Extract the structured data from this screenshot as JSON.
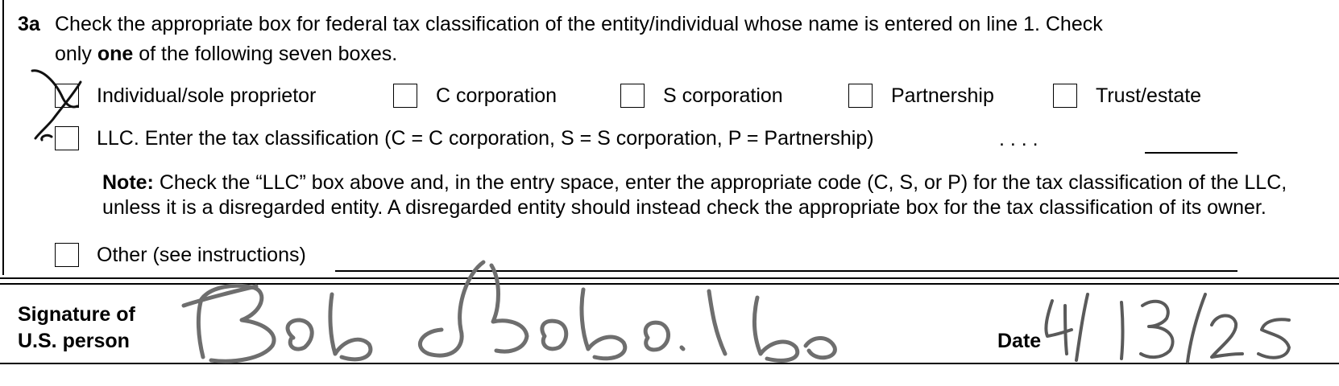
{
  "section3a": {
    "number": "3a",
    "instruction_part1": "Check the appropriate box for federal tax classification of the entity/individual whose name is entered on line 1. Check",
    "instruction_part2_pre": "only ",
    "instruction_part2_bold": "one",
    "instruction_part2_post": " of the following seven boxes.",
    "options": [
      {
        "label": "Individual/sole proprietor",
        "checked": true
      },
      {
        "label": "C corporation",
        "checked": false
      },
      {
        "label": "S corporation",
        "checked": false
      },
      {
        "label": "Partnership",
        "checked": false
      },
      {
        "label": "Trust/estate",
        "checked": false
      }
    ],
    "llc": {
      "label": "LLC. Enter the tax classification (C = C corporation, S = S corporation, P = Partnership)",
      "leaders": ".  .  .  .",
      "value": "",
      "checked": false
    },
    "note": {
      "label": "Note:",
      "text": " Check the “LLC” box above and, in the entry space, enter the appropriate code (C, S, or P) for the tax classification of the LLC, unless it is a disregarded entity. A disregarded entity should instead check the appropriate box for the tax classification of its owner."
    },
    "other": {
      "label": "Other (see instructions)",
      "value": "",
      "checked": false
    }
  },
  "signature": {
    "label_line1": "Signature of",
    "label_line2": "U.S. person",
    "signed_name": "Bob Bobo.bo",
    "date_label": "Date",
    "date_value": "4/13/25"
  },
  "colors": {
    "ink": "#000000",
    "signature_ink": "#6e6e6e",
    "date_ink": "#5a5a5a"
  }
}
